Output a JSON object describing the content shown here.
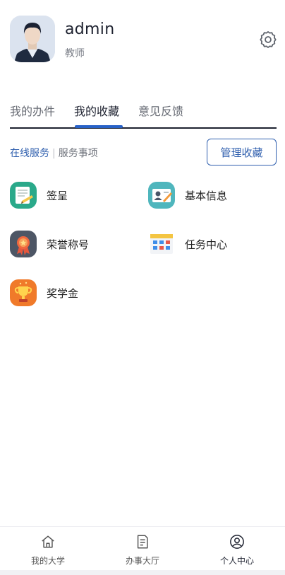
{
  "profile": {
    "username": "admin",
    "role": "教师",
    "avatar_icon": "user-avatar",
    "settings_icon": "gear-icon"
  },
  "tabs": [
    {
      "label": "我的办件",
      "active": false
    },
    {
      "label": "我的收藏",
      "active": true
    },
    {
      "label": "意见反馈",
      "active": false
    }
  ],
  "subnav": {
    "online_services": "在线服务",
    "separator": "|",
    "service_items": "服务事项",
    "manage_button": "管理收藏"
  },
  "services": [
    {
      "label": "签呈",
      "icon": "document-sign-icon",
      "color": "#2aa98a"
    },
    {
      "label": "基本信息",
      "icon": "id-card-icon",
      "color": "#4fb6bd"
    },
    {
      "label": "荣誉称号",
      "icon": "medal-icon",
      "color": "#4d5665"
    },
    {
      "label": "任务中心",
      "icon": "calendar-grid-icon",
      "color": "#f4c542"
    },
    {
      "label": "奖学金",
      "icon": "trophy-icon",
      "color": "#f07a2a"
    }
  ],
  "bottom_nav": [
    {
      "label": "我的大学",
      "icon": "home-icon",
      "active": false
    },
    {
      "label": "办事大厅",
      "icon": "document-icon",
      "active": false
    },
    {
      "label": "个人中心",
      "icon": "user-circle-icon",
      "active": true
    }
  ],
  "colors": {
    "accent": "#2f5fae",
    "tab_indicator": "#2862c8"
  }
}
